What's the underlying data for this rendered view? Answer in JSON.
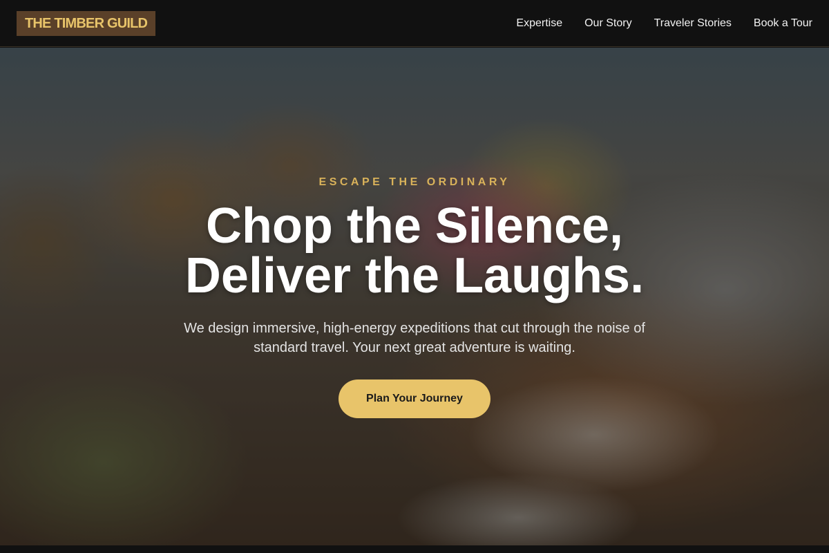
{
  "header": {
    "logo": "THE TIMBER GUILD",
    "nav": [
      {
        "label": "Expertise"
      },
      {
        "label": "Our Story"
      },
      {
        "label": "Traveler Stories"
      },
      {
        "label": "Book a Tour"
      }
    ]
  },
  "hero": {
    "eyebrow": "ESCAPE THE ORDINARY",
    "headline_line1": "Chop the Silence,",
    "headline_line2": "Deliver the Laughs.",
    "subtext": "We design immersive, high-energy expeditions that cut through the noise of standard travel. Your next great adventure is waiting.",
    "cta_label": "Plan Your Journey"
  },
  "colors": {
    "accent": "#e8c46a",
    "logo_bg": "#5a4029",
    "nav_bg": "#111111"
  }
}
